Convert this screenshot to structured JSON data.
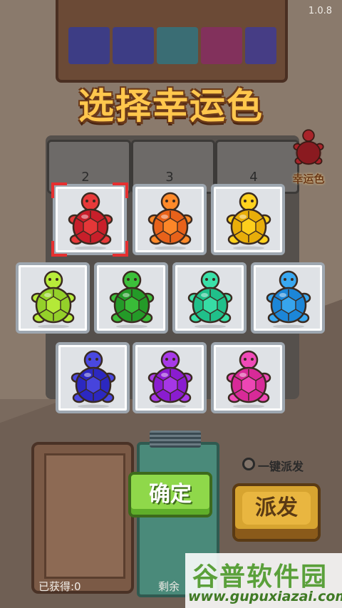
{
  "version": "1.0.8",
  "title": "选择幸运色",
  "columns": [
    "2",
    "3",
    "4"
  ],
  "lucky_side_label": "幸运色",
  "colors": [
    {
      "name": "red",
      "body": "#e83a3a",
      "shell": "#c81f2a"
    },
    {
      "name": "orange",
      "body": "#ff8a2a",
      "shell": "#e8621a"
    },
    {
      "name": "yellow",
      "body": "#ffd21e",
      "shell": "#e8ae0a"
    },
    {
      "name": "lime",
      "body": "#b8ec3a",
      "shell": "#94d02a"
    },
    {
      "name": "green",
      "body": "#3cc03a",
      "shell": "#249a28"
    },
    {
      "name": "mint",
      "body": "#3ae0a8",
      "shell": "#20c08a"
    },
    {
      "name": "sky-blue",
      "body": "#3aa8f0",
      "shell": "#1c86d8"
    },
    {
      "name": "blue",
      "body": "#4a48e0",
      "shell": "#2c28c0"
    },
    {
      "name": "purple",
      "body": "#a83ae8",
      "shell": "#8a1cd0"
    },
    {
      "name": "pink",
      "body": "#f04ab8",
      "shell": "#d82a98"
    }
  ],
  "selected_color": "red",
  "selection_color": "#e53030",
  "confirm_label": "确定",
  "auto_dispatch_label": "一键派发",
  "dispatch_label": "派发",
  "obtained_label": "已获得:0",
  "remaining_label": "剩余",
  "watermark": {
    "title": "谷普软件园",
    "url": "www.gupuxiazai.com"
  }
}
